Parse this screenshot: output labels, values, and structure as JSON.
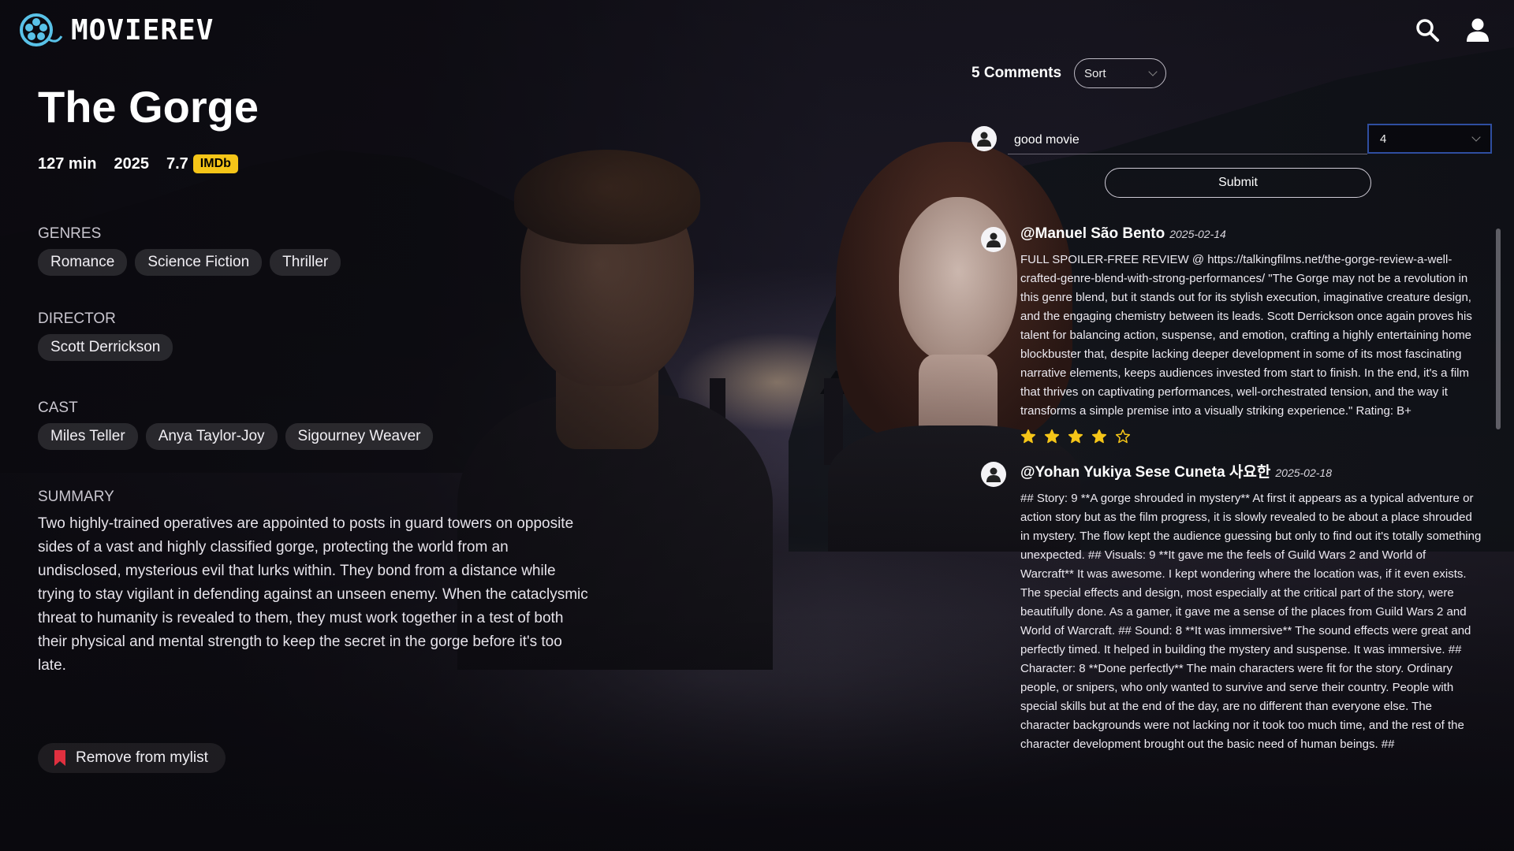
{
  "app": {
    "logo_text": "MOVIEREV"
  },
  "movie": {
    "title": "The Gorge",
    "runtime": "127 min",
    "year": "2025",
    "imdb_rating": "7.7",
    "imdb_badge": "IMDb",
    "genres_label": "GENRES",
    "genres": [
      "Romance",
      "Science Fiction",
      "Thriller"
    ],
    "director_label": "DIRECTOR",
    "directors": [
      "Scott Derrickson"
    ],
    "cast_label": "CAST",
    "cast": [
      "Miles Teller",
      "Anya Taylor-Joy",
      "Sigourney Weaver"
    ],
    "summary_label": "SUMMARY",
    "summary": "Two highly-trained operatives are appointed to posts in guard towers on opposite sides of a vast and highly classified gorge, protecting the world from an undisclosed, mysterious evil that lurks within. They bond from a distance while trying to stay vigilant in defending against an unseen enemy. When the cataclysmic threat to humanity is revealed to them, they must work together in a test of both their physical and mental strength to keep the secret in the gorge before it's too late.",
    "mylist_button": "Remove from mylist"
  },
  "comments": {
    "count_label": "5 Comments",
    "sort_placeholder": "Sort",
    "compose_value": "good movie",
    "rating_value": "4",
    "submit_label": "Submit",
    "items": [
      {
        "author": "@Manuel São Bento",
        "date": "2025-02-14",
        "body": "FULL SPOILER-FREE REVIEW @ https://talkingfilms.net/the-gorge-review-a-well-crafted-genre-blend-with-strong-performances/ \"The Gorge may not be a revolution in this genre blend, but it stands out for its stylish execution, imaginative creature design, and the engaging chemistry between its leads. Scott Derrickson once again proves his talent for balancing action, suspense, and emotion, crafting a highly entertaining home blockbuster that, despite lacking deeper development in some of its most fascinating narrative elements, keeps audiences invested from start to finish. In the end, it's a film that thrives on captivating performances, well-orchestrated tension, and the way it transforms a simple premise into a visually striking experience.\" Rating: B+",
        "stars": 4,
        "max_stars": 5
      },
      {
        "author": "@Yohan Yukiya Sese Cuneta 사요한",
        "date": "2025-02-18",
        "body": "## Story: 9 **A gorge shrouded in mystery** At first it appears as a typical adventure or action story but as the film progress, it is slowly revealed to be about a place shrouded in mystery. The flow kept the audience guessing but only to find out it's totally something unexpected. ## Visuals: 9 **It gave me the feels of Guild Wars 2 and World of Warcraft** It was awesome. I kept wondering where the location was, if it even exists. The special effects and design, most especially at the critical part of the story, were beautifully done. As a gamer, it gave me a sense of the places from Guild Wars 2 and World of Warcraft. ## Sound: 8 **It was immersive** The sound effects were great and perfectly timed. It helped in building the mystery and suspense. It was immersive. ## Character: 8 **Done perfectly** The main characters were fit for the story. Ordinary people, or snipers, who only wanted to survive and serve their country. People with special skills but at the end of the day, are no different than everyone else. The character backgrounds were not lacking nor it took too much time, and the rest of the character development brought out the basic need of human beings. ##"
      }
    ]
  },
  "icons": {
    "logo": "film-reel-icon",
    "search": "search-icon",
    "profile": "user-icon",
    "bookmark": "bookmark-icon",
    "star": "star-icon"
  },
  "colors": {
    "imdb": "#f5c518",
    "star": "#f5c518",
    "bookmark": "#e0303f",
    "focus_border": "#2f4ea0"
  }
}
